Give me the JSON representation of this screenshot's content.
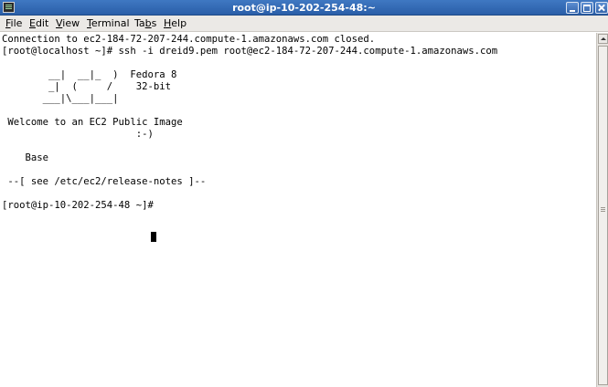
{
  "window": {
    "title": "root@ip-10-202-254-48:~"
  },
  "menu": [
    {
      "label": "File"
    },
    {
      "label": "Edit"
    },
    {
      "label": "View"
    },
    {
      "label": "Terminal"
    },
    {
      "label": "Tabs"
    },
    {
      "label": "Help"
    }
  ],
  "terminal": {
    "lines": [
      "Connection to ec2-184-72-207-244.compute-1.amazonaws.com closed.",
      "[root@localhost ~]# ssh -i dreid9.pem root@ec2-184-72-207-244.compute-1.amazonaws.com",
      "",
      "        __|  __|_  )  Fedora 8",
      "        _|  (     /    32-bit",
      "       ___|\\___|___|",
      "",
      " Welcome to an EC2 Public Image",
      "                       :-)",
      "",
      "    Base",
      "",
      " --[ see /etc/ec2/release-notes ]--",
      "",
      "[root@ip-10-202-254-48 ~]# "
    ]
  },
  "icons": {
    "app": "terminal-icon",
    "minimize": "minimize-icon",
    "maximize": "maximize-icon",
    "close": "close-icon"
  }
}
